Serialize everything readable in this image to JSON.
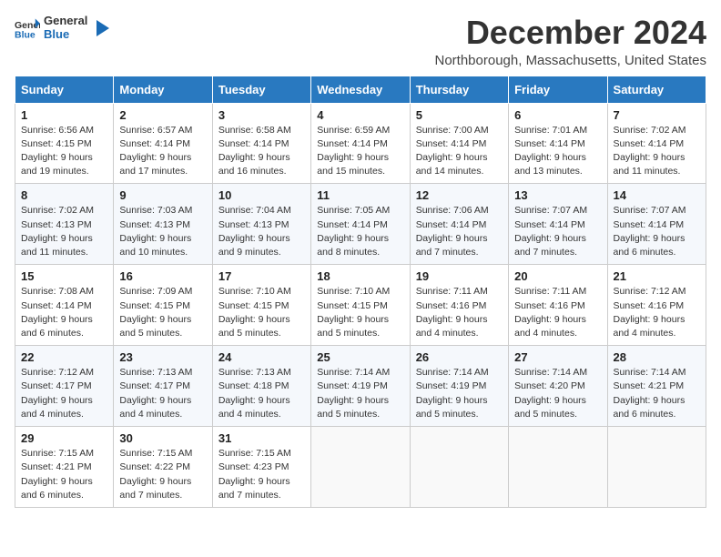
{
  "header": {
    "logo_line1": "General",
    "logo_line2": "Blue",
    "title": "December 2024",
    "subtitle": "Northborough, Massachusetts, United States"
  },
  "calendar": {
    "weekdays": [
      "Sunday",
      "Monday",
      "Tuesday",
      "Wednesday",
      "Thursday",
      "Friday",
      "Saturday"
    ],
    "weeks": [
      [
        {
          "day": "1",
          "sunrise": "6:56 AM",
          "sunset": "4:15 PM",
          "daylight": "9 hours and 19 minutes."
        },
        {
          "day": "2",
          "sunrise": "6:57 AM",
          "sunset": "4:14 PM",
          "daylight": "9 hours and 17 minutes."
        },
        {
          "day": "3",
          "sunrise": "6:58 AM",
          "sunset": "4:14 PM",
          "daylight": "9 hours and 16 minutes."
        },
        {
          "day": "4",
          "sunrise": "6:59 AM",
          "sunset": "4:14 PM",
          "daylight": "9 hours and 15 minutes."
        },
        {
          "day": "5",
          "sunrise": "7:00 AM",
          "sunset": "4:14 PM",
          "daylight": "9 hours and 14 minutes."
        },
        {
          "day": "6",
          "sunrise": "7:01 AM",
          "sunset": "4:14 PM",
          "daylight": "9 hours and 13 minutes."
        },
        {
          "day": "7",
          "sunrise": "7:02 AM",
          "sunset": "4:14 PM",
          "daylight": "9 hours and 11 minutes."
        }
      ],
      [
        {
          "day": "8",
          "sunrise": "7:02 AM",
          "sunset": "4:13 PM",
          "daylight": "9 hours and 11 minutes."
        },
        {
          "day": "9",
          "sunrise": "7:03 AM",
          "sunset": "4:13 PM",
          "daylight": "9 hours and 10 minutes."
        },
        {
          "day": "10",
          "sunrise": "7:04 AM",
          "sunset": "4:13 PM",
          "daylight": "9 hours and 9 minutes."
        },
        {
          "day": "11",
          "sunrise": "7:05 AM",
          "sunset": "4:14 PM",
          "daylight": "9 hours and 8 minutes."
        },
        {
          "day": "12",
          "sunrise": "7:06 AM",
          "sunset": "4:14 PM",
          "daylight": "9 hours and 7 minutes."
        },
        {
          "day": "13",
          "sunrise": "7:07 AM",
          "sunset": "4:14 PM",
          "daylight": "9 hours and 7 minutes."
        },
        {
          "day": "14",
          "sunrise": "7:07 AM",
          "sunset": "4:14 PM",
          "daylight": "9 hours and 6 minutes."
        }
      ],
      [
        {
          "day": "15",
          "sunrise": "7:08 AM",
          "sunset": "4:14 PM",
          "daylight": "9 hours and 6 minutes."
        },
        {
          "day": "16",
          "sunrise": "7:09 AM",
          "sunset": "4:15 PM",
          "daylight": "9 hours and 5 minutes."
        },
        {
          "day": "17",
          "sunrise": "7:10 AM",
          "sunset": "4:15 PM",
          "daylight": "9 hours and 5 minutes."
        },
        {
          "day": "18",
          "sunrise": "7:10 AM",
          "sunset": "4:15 PM",
          "daylight": "9 hours and 5 minutes."
        },
        {
          "day": "19",
          "sunrise": "7:11 AM",
          "sunset": "4:16 PM",
          "daylight": "9 hours and 4 minutes."
        },
        {
          "day": "20",
          "sunrise": "7:11 AM",
          "sunset": "4:16 PM",
          "daylight": "9 hours and 4 minutes."
        },
        {
          "day": "21",
          "sunrise": "7:12 AM",
          "sunset": "4:16 PM",
          "daylight": "9 hours and 4 minutes."
        }
      ],
      [
        {
          "day": "22",
          "sunrise": "7:12 AM",
          "sunset": "4:17 PM",
          "daylight": "9 hours and 4 minutes."
        },
        {
          "day": "23",
          "sunrise": "7:13 AM",
          "sunset": "4:17 PM",
          "daylight": "9 hours and 4 minutes."
        },
        {
          "day": "24",
          "sunrise": "7:13 AM",
          "sunset": "4:18 PM",
          "daylight": "9 hours and 4 minutes."
        },
        {
          "day": "25",
          "sunrise": "7:14 AM",
          "sunset": "4:19 PM",
          "daylight": "9 hours and 5 minutes."
        },
        {
          "day": "26",
          "sunrise": "7:14 AM",
          "sunset": "4:19 PM",
          "daylight": "9 hours and 5 minutes."
        },
        {
          "day": "27",
          "sunrise": "7:14 AM",
          "sunset": "4:20 PM",
          "daylight": "9 hours and 5 minutes."
        },
        {
          "day": "28",
          "sunrise": "7:14 AM",
          "sunset": "4:21 PM",
          "daylight": "9 hours and 6 minutes."
        }
      ],
      [
        {
          "day": "29",
          "sunrise": "7:15 AM",
          "sunset": "4:21 PM",
          "daylight": "9 hours and 6 minutes."
        },
        {
          "day": "30",
          "sunrise": "7:15 AM",
          "sunset": "4:22 PM",
          "daylight": "9 hours and 7 minutes."
        },
        {
          "day": "31",
          "sunrise": "7:15 AM",
          "sunset": "4:23 PM",
          "daylight": "9 hours and 7 minutes."
        },
        null,
        null,
        null,
        null
      ]
    ]
  }
}
